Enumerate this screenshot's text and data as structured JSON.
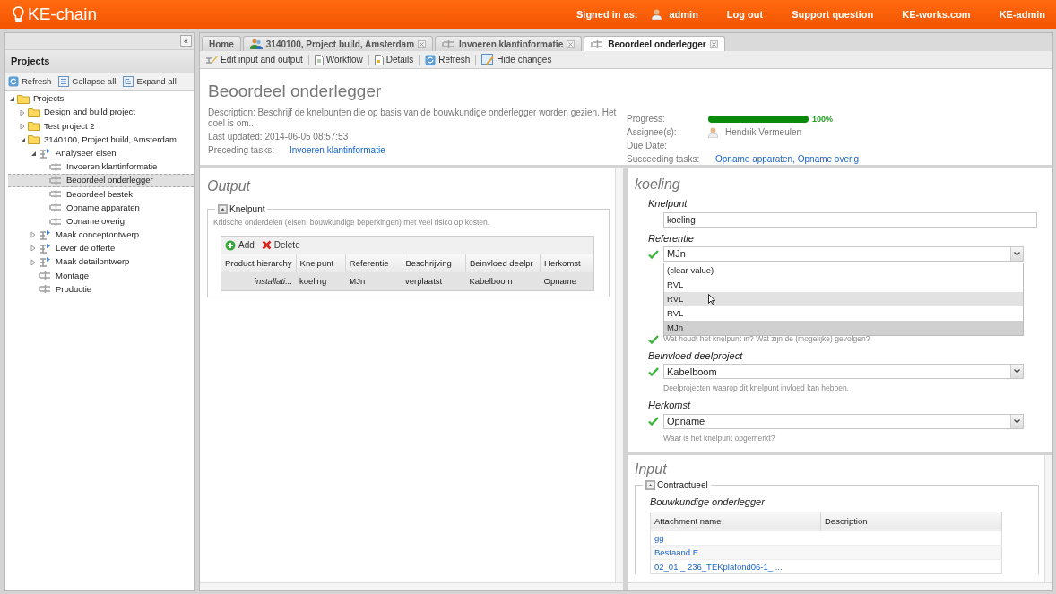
{
  "header": {
    "logo": "KE-chain",
    "signed_in_label": "Signed in as:",
    "user": "admin",
    "links": [
      "Log out",
      "Support question",
      "KE-works.com",
      "KE-admin"
    ]
  },
  "sidebar": {
    "collapse": "«",
    "title": "Projects",
    "tools": [
      {
        "label": "Refresh",
        "kind": "refresh"
      },
      {
        "label": "Collapse all",
        "kind": "collapse"
      },
      {
        "label": "Expand all",
        "kind": "expand"
      }
    ],
    "tree": [
      {
        "label": "Projects",
        "kind": "folder",
        "expanded": true,
        "selected": false,
        "children": [
          {
            "label": "Design and build project",
            "kind": "folder",
            "expanded": false,
            "selected": false
          },
          {
            "label": "Test project 2",
            "kind": "folder",
            "expanded": false,
            "selected": false
          },
          {
            "label": "3140100, Project build, Amsterdam",
            "kind": "folder",
            "expanded": true,
            "selected": false,
            "children": [
              {
                "label": "Analyseer eisen",
                "kind": "process",
                "expanded": true,
                "selected": false,
                "children": [
                  {
                    "label": "Invoeren klantinformatie",
                    "kind": "task",
                    "selected": false
                  },
                  {
                    "label": "Beoordeel onderlegger",
                    "kind": "task",
                    "selected": true
                  },
                  {
                    "label": "Beoordeel bestek",
                    "kind": "task",
                    "selected": false
                  },
                  {
                    "label": "Opname apparaten",
                    "kind": "task",
                    "selected": false
                  },
                  {
                    "label": "Opname overig",
                    "kind": "task",
                    "selected": false
                  }
                ]
              },
              {
                "label": "Maak conceptontwerp",
                "kind": "process",
                "expanded": false,
                "selected": false
              },
              {
                "label": "Lever de offerte",
                "kind": "process",
                "expanded": false,
                "selected": false
              },
              {
                "label": "Maak detailontwerp",
                "kind": "process",
                "expanded": false,
                "selected": false
              },
              {
                "label": "Montage",
                "kind": "task",
                "selected": false
              },
              {
                "label": "Productie",
                "kind": "task",
                "selected": false
              }
            ]
          }
        ]
      }
    ]
  },
  "tabs": [
    {
      "label": "Home",
      "kind": "plain",
      "closable": false,
      "selected": false
    },
    {
      "label": "3140100, Project build, Amsterdam",
      "kind": "team",
      "closable": true,
      "selected": false
    },
    {
      "label": "Invoeren klantinformatie",
      "kind": "task",
      "closable": true,
      "selected": false
    },
    {
      "label": "Beoordeel onderlegger",
      "kind": "task",
      "closable": true,
      "selected": true
    }
  ],
  "toolbar": [
    {
      "label": "Edit input and output",
      "kind": "edit"
    },
    {
      "label": "Workflow",
      "kind": "doc"
    },
    {
      "label": "Details",
      "kind": "details"
    },
    {
      "label": "Refresh",
      "kind": "refresh"
    },
    {
      "label": "Hide changes",
      "kind": "hide"
    }
  ],
  "task": {
    "title": "Beoordeel onderlegger",
    "description": "Description: Beschrijf de knelpunten die op basis van de bouwkundige onderlegger worden gezien. Het doel is om...",
    "last_updated": "Last updated: 2014-06-05 08:57:53",
    "preceding_label": "Preceding tasks:",
    "preceding": "Invoeren klantinformatie",
    "progress_label": "Progress:",
    "progress": {
      "level": 1,
      "reading": "100%"
    },
    "assignee_label": "Assignee(s):",
    "assignee": "Hendrik Vermeulen",
    "due_label": "Due Date:",
    "succeeding_label": "Succeeding tasks:",
    "succeeding": "Opname apparaten, Opname overig"
  },
  "output": {
    "title": "Output",
    "legend": "Knelpunt",
    "description": "Kritische onderdelen (eisen, bouwkundige beperkingen) met veel risico op kosten.",
    "actions": [
      {
        "label": "Add",
        "kind": "add"
      },
      {
        "label": "Delete",
        "kind": "delete"
      }
    ],
    "columns": [
      "Product hierarchy",
      "Knelpunt",
      "Referentie",
      "Beschrijving",
      "Beinvloed deelpr",
      "Herkomst"
    ],
    "rows": [
      [
        "installati...",
        "koeling",
        "MJn",
        "verplaatst",
        "Kabelboom",
        "Opname"
      ]
    ]
  },
  "detail": {
    "title": "koeling",
    "fields": [
      {
        "kind": "text",
        "label": "Knelpunt",
        "value": "koeling",
        "valid": false
      },
      {
        "kind": "select",
        "label": "Referentie",
        "value": "MJn",
        "valid": true,
        "options": [
          {
            "label": "(clear value)",
            "hovered": false,
            "selected": false
          },
          {
            "label": "RVL",
            "hovered": false,
            "selected": false
          },
          {
            "label": "RVL",
            "hovered": true,
            "selected": false
          },
          {
            "label": "RVL",
            "hovered": false,
            "selected": false
          },
          {
            "label": "MJn",
            "hovered": false,
            "selected": true
          }
        ]
      },
      {
        "kind": "covered",
        "valid": true,
        "help": "Wat houdt het knelpunt in? Wat zijn de (mogelijke) gevolgen?"
      },
      {
        "kind": "select",
        "label": "Beinvloed deelproject",
        "value": "Kabelboom",
        "valid": true,
        "help": "Deelprojecten waarop dit knelpunt invloed kan hebben."
      },
      {
        "kind": "select",
        "label": "Herkomst",
        "value": "Opname",
        "valid": true,
        "help": "Waar is het knelpunt opgemerkt?"
      }
    ]
  },
  "input": {
    "title": "Input",
    "legend": "Contractueel",
    "subtitle": "Bouwkundige onderlegger",
    "columns": [
      "Attachment name",
      "Description"
    ],
    "rows": [
      "gg",
      "Bestaand E",
      "02_01 _ 236_TEKplafond06-1_ ..."
    ]
  }
}
